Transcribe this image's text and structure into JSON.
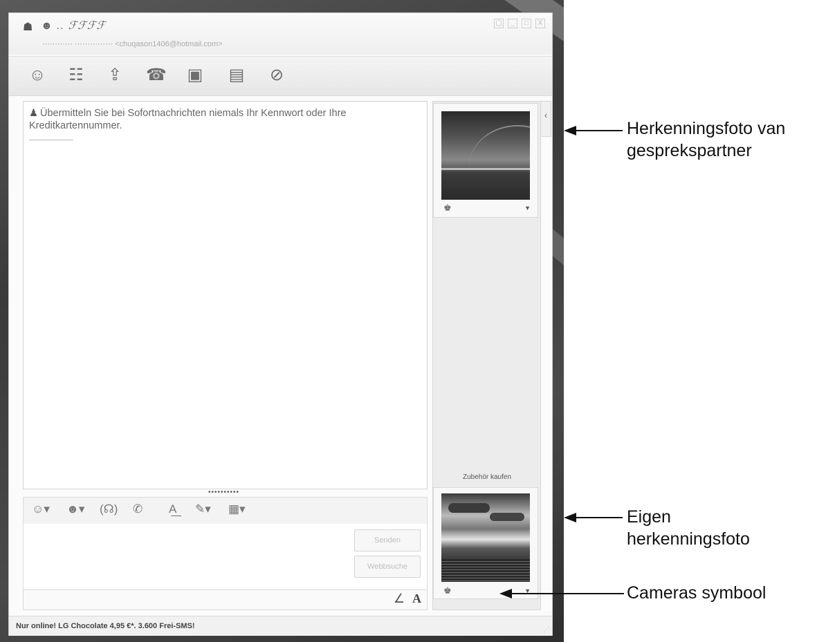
{
  "window": {
    "title_name": "☻ .. ℱℱℱℱ",
    "title_sub": "⋯⋯⋯⋯ ⋯⋯⋯⋯⋯ <chuqason1406@hotmail.com>",
    "controls": [
      "▢",
      "_",
      "□",
      "X"
    ]
  },
  "toolbar": {
    "icons": [
      "invite-contact-icon",
      "contacts-icon",
      "share-files-icon",
      "call-icon",
      "video-icon",
      "activities-icon",
      "block-icon"
    ]
  },
  "chat": {
    "warning": "Übermitteln Sie bei Sofortnachrichten niemals Ihr Kennwort oder Ihre Kreditkartennummer."
  },
  "format_bar": {
    "icons": [
      "emoticon-icon",
      "wink-icon",
      "voice-clip-icon",
      "nudge-icon",
      "font-icon",
      "background-icon",
      "handwriting-icon"
    ]
  },
  "input": {
    "send_label": "Senden",
    "search_label": "Webbsuche"
  },
  "side": {
    "shop_link": "Zubehör kaufen"
  },
  "status": {
    "text": "Nur online! LG Chocolate 4,95 €*. 3.600 Frei-SMS!"
  },
  "annotations": {
    "partner_photo": [
      "Herkenningsfoto van",
      "gesprekspartner"
    ],
    "own_photo": [
      "Eigen",
      "herkenningsfoto"
    ],
    "camera_symbol": "Cameras symbool"
  }
}
